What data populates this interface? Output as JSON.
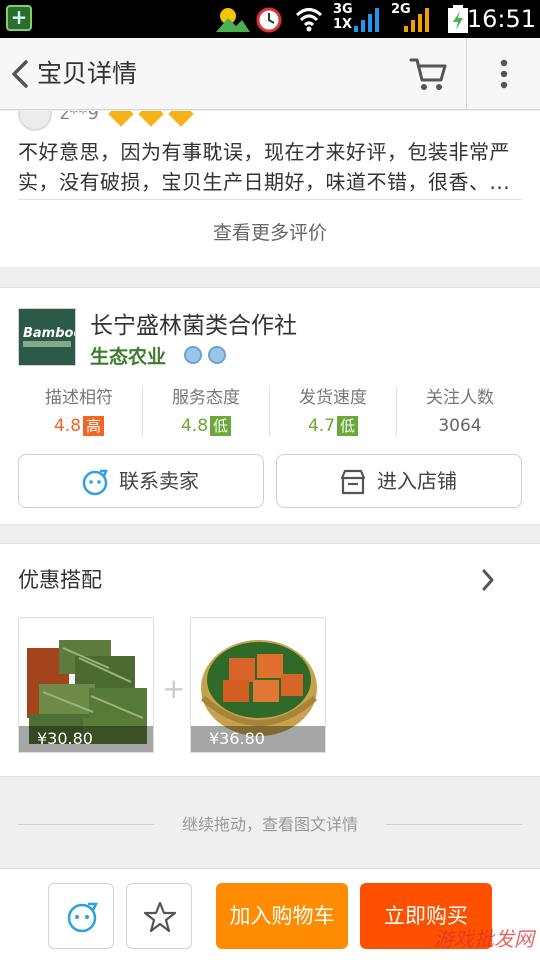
{
  "status_bar": {
    "time": "16:51",
    "net_3g": "3G",
    "net_1x": "1X",
    "net_2g": "2G"
  },
  "header": {
    "title": "宝贝详情"
  },
  "review": {
    "reviewer": "z**9",
    "text": "不好意思，因为有事耽误，现在才来好评，包装非常严实，没有破损，宝贝生产日期好，味道不错，很香、...",
    "more_label": "查看更多评价"
  },
  "shop": {
    "logo_text": "Bamboo",
    "name": "长宁盛林菌类合作社",
    "tag": "生态农业",
    "metrics": [
      {
        "label": "描述相符",
        "value": "4.8",
        "badge": "高",
        "color": "#f26522"
      },
      {
        "label": "服务态度",
        "value": "4.8",
        "badge": "低",
        "color": "#6aa83a"
      },
      {
        "label": "发货速度",
        "value": "4.7",
        "badge": "低",
        "color": "#6aa83a"
      },
      {
        "label": "关注人数",
        "value": "3064",
        "badge": "",
        "color": "#666666"
      }
    ],
    "contact_label": "联系卖家",
    "enter_label": "进入店铺"
  },
  "combo": {
    "title": "优惠搭配",
    "items": [
      {
        "price": "¥30.80"
      },
      {
        "price": "¥36.80"
      }
    ],
    "plus": "+"
  },
  "continue_text": "继续拖动，查看图文详情",
  "bottom": {
    "add_cart_label": "加入购物车",
    "buy_label": "立即购买",
    "add_cart_color": "#ff8c00",
    "buy_color": "#ff5000"
  },
  "watermark": "游戏批发网"
}
